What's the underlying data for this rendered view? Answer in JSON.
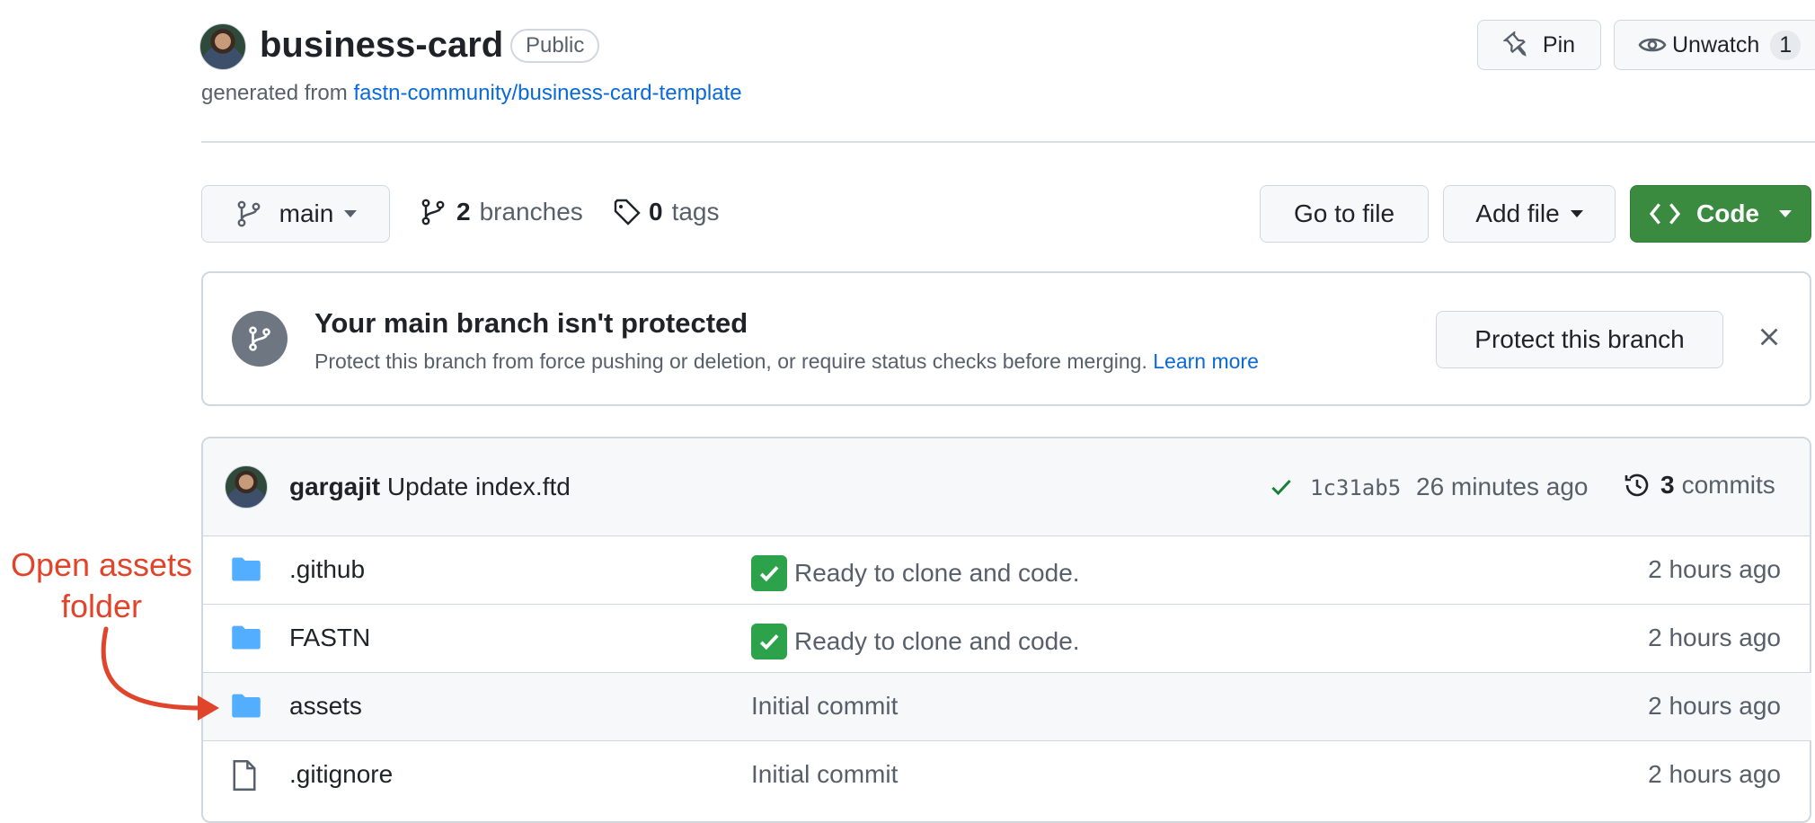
{
  "repo": {
    "name": "business-card",
    "visibility": "Public",
    "generated_prefix": "generated from",
    "template_link": "fastn-community/business-card-template"
  },
  "header_actions": {
    "pin_label": "Pin",
    "unwatch_label": "Unwatch",
    "watch_count": "1"
  },
  "toolbar": {
    "branch": "main",
    "branches_count": "2",
    "branches_label": "branches",
    "tags_count": "0",
    "tags_label": "tags",
    "go_to_file": "Go to file",
    "add_file": "Add file",
    "code": "Code"
  },
  "banner": {
    "title": "Your main branch isn't protected",
    "description": "Protect this branch from force pushing or deletion, or require status checks before merging.",
    "learn_more": "Learn more",
    "protect_button": "Protect this branch"
  },
  "latest_commit": {
    "author": "gargajit",
    "message": "Update index.ftd",
    "sha": "1c31ab5",
    "time": "26 minutes ago",
    "commits_count": "3",
    "commits_label": "commits"
  },
  "files": [
    {
      "name": ".github",
      "type": "folder",
      "message": "Ready to clone and code.",
      "checkmark": true,
      "age": "2 hours ago"
    },
    {
      "name": "FASTN",
      "type": "folder",
      "message": "Ready to clone and code.",
      "checkmark": true,
      "age": "2 hours ago"
    },
    {
      "name": "assets",
      "type": "folder",
      "message": "Initial commit",
      "checkmark": false,
      "age": "2 hours ago"
    },
    {
      "name": ".gitignore",
      "type": "file",
      "message": "Initial commit",
      "checkmark": false,
      "age": "2 hours ago"
    }
  ],
  "annotation": {
    "line1": "Open assets",
    "line2": "folder",
    "color": "#e0442a"
  },
  "colors": {
    "link": "#0969da",
    "code_button": "#3a8a3f",
    "folder_icon": "#54aeff",
    "success": "#1a7f37"
  }
}
